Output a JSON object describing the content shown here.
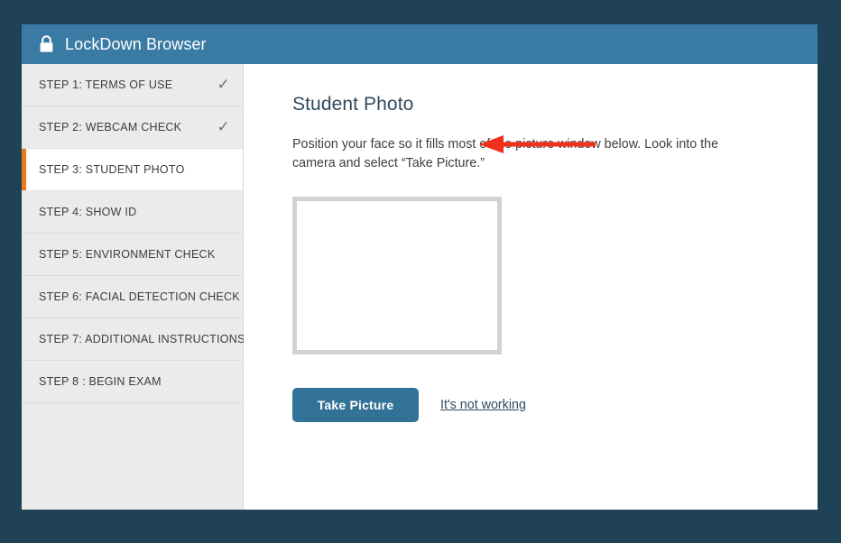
{
  "window": {
    "title": "LockDown Browser",
    "lock_icon": "lock-icon",
    "header_color": "#3a7ba3",
    "background_color": "#1f4257"
  },
  "sidebar": {
    "accent_color": "#e8791e",
    "items": [
      {
        "label": "STEP 1: TERMS OF USE",
        "completed": true,
        "active": false,
        "check": "✓"
      },
      {
        "label": "STEP 2: WEBCAM CHECK",
        "completed": true,
        "active": false,
        "check": "✓"
      },
      {
        "label": "STEP 3: STUDENT PHOTO",
        "completed": false,
        "active": true,
        "check": ""
      },
      {
        "label": "STEP 4: SHOW ID",
        "completed": false,
        "active": false,
        "check": ""
      },
      {
        "label": "STEP 5: ENVIRONMENT CHECK",
        "completed": false,
        "active": false,
        "check": ""
      },
      {
        "label": "STEP 6: FACIAL DETECTION CHECK",
        "completed": false,
        "active": false,
        "check": ""
      },
      {
        "label": "STEP 7: ADDITIONAL INSTRUCTIONS",
        "completed": false,
        "active": false,
        "check": ""
      },
      {
        "label": "STEP 8 : BEGIN EXAM",
        "completed": false,
        "active": false,
        "check": ""
      }
    ]
  },
  "main": {
    "heading": "Student Photo",
    "instructions": "Position your face so it fills most of the picture window below. Look into the camera and select “Take Picture.”",
    "photo_preview": {
      "name": "photo-preview-window",
      "content": ""
    },
    "take_picture_label": "Take Picture",
    "take_picture_color": "#337297",
    "not_working_label": "It's not working"
  },
  "annotation": {
    "name": "red-arrow-pointing-to-link",
    "color": "#f03018",
    "direction": "left"
  }
}
